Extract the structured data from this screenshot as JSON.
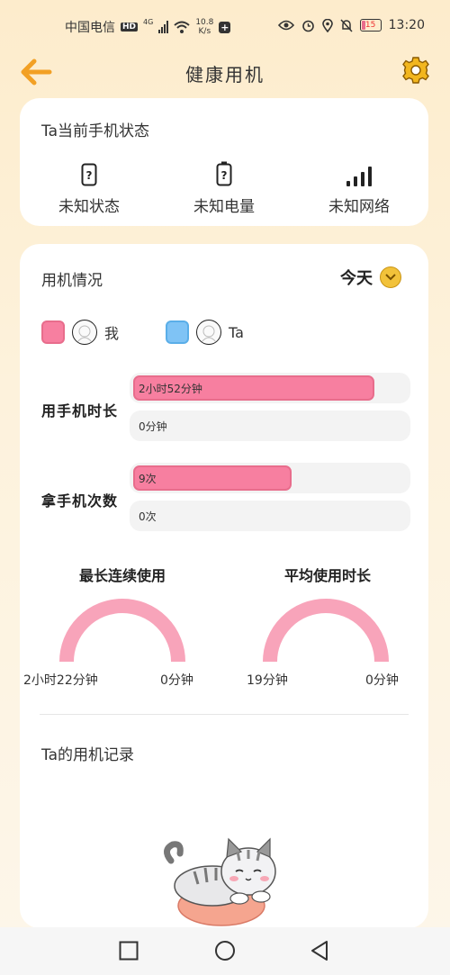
{
  "status_bar": {
    "carrier": "中国电信",
    "hd": "HD",
    "network": "4G",
    "speed_value": "10.8",
    "speed_unit": "K/s",
    "battery": "15",
    "time": "13:20"
  },
  "header": {
    "title": "健康用机",
    "back_icon": "back-arrow-icon",
    "settings_icon": "gear-icon"
  },
  "phone_status": {
    "title": "Ta当前手机状态",
    "items": [
      {
        "icon": "phone-unknown-icon",
        "label": "未知状态"
      },
      {
        "icon": "battery-unknown-icon",
        "label": "未知电量"
      },
      {
        "icon": "signal-icon",
        "label": "未知网络"
      }
    ]
  },
  "usage": {
    "title": "用机情况",
    "period": "今天",
    "legend": [
      {
        "name": "我",
        "color": "#f77fa0"
      },
      {
        "name": "Ta",
        "color": "#7fc3f5"
      }
    ],
    "duration": {
      "label": "用手机时长",
      "me": {
        "text": "2小时52分钟",
        "fraction": 0.88
      },
      "ta": {
        "text": "0分钟",
        "fraction": 0
      }
    },
    "pickups": {
      "label": "拿手机次数",
      "me": {
        "text": "9次",
        "fraction": 0.58
      },
      "ta": {
        "text": "0次",
        "fraction": 0
      }
    },
    "longest": {
      "title": "最长连续使用",
      "me": "2小时22分钟",
      "ta": "0分钟"
    },
    "average": {
      "title": "平均使用时长",
      "me": "19分钟",
      "ta": "0分钟"
    },
    "records_title": "Ta的用机记录"
  },
  "colors": {
    "accent": "#f2c23a",
    "pink": "#f77fa0",
    "blue": "#7fc3f5",
    "back_arrow": "#f2a024"
  },
  "navbar": {
    "icons": [
      "recent-apps-icon",
      "home-icon",
      "back-icon"
    ]
  }
}
